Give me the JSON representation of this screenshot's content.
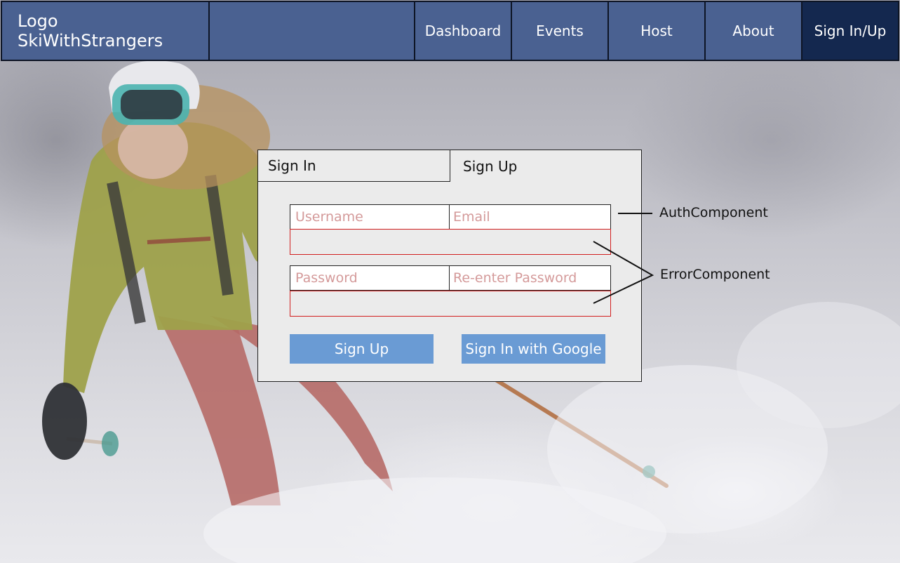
{
  "nav": {
    "logo": "Logo SkiWithStrangers",
    "items": [
      {
        "label": "Dashboard"
      },
      {
        "label": "Events"
      },
      {
        "label": "Host"
      },
      {
        "label": "About"
      },
      {
        "label": "Sign In/Up"
      }
    ],
    "active_item": "Sign In/Up"
  },
  "auth": {
    "tabs": [
      {
        "label": "Sign In"
      },
      {
        "label": "Sign Up"
      }
    ],
    "active_tab": "Sign Up",
    "fields": {
      "username": {
        "placeholder": "Username",
        "value": ""
      },
      "email": {
        "placeholder": "Email",
        "value": ""
      },
      "password": {
        "placeholder": "Password",
        "value": ""
      },
      "reenter_password": {
        "placeholder": "Re-enter Password",
        "value": ""
      }
    },
    "buttons": {
      "signup": "Sign Up",
      "google": "Sign In with Google"
    }
  },
  "annotations": {
    "auth_component": "AuthComponent",
    "error_component": "ErrorComponent"
  },
  "colors": {
    "nav_bg": "#4a6191",
    "nav_active_bg": "#14284f",
    "button_bg": "#6a9bd4",
    "placeholder_text": "#d49a9a",
    "error_border": "#d21f1f",
    "card_bg": "#ebebeb"
  },
  "background": {
    "description_icon": "skier-photo"
  }
}
